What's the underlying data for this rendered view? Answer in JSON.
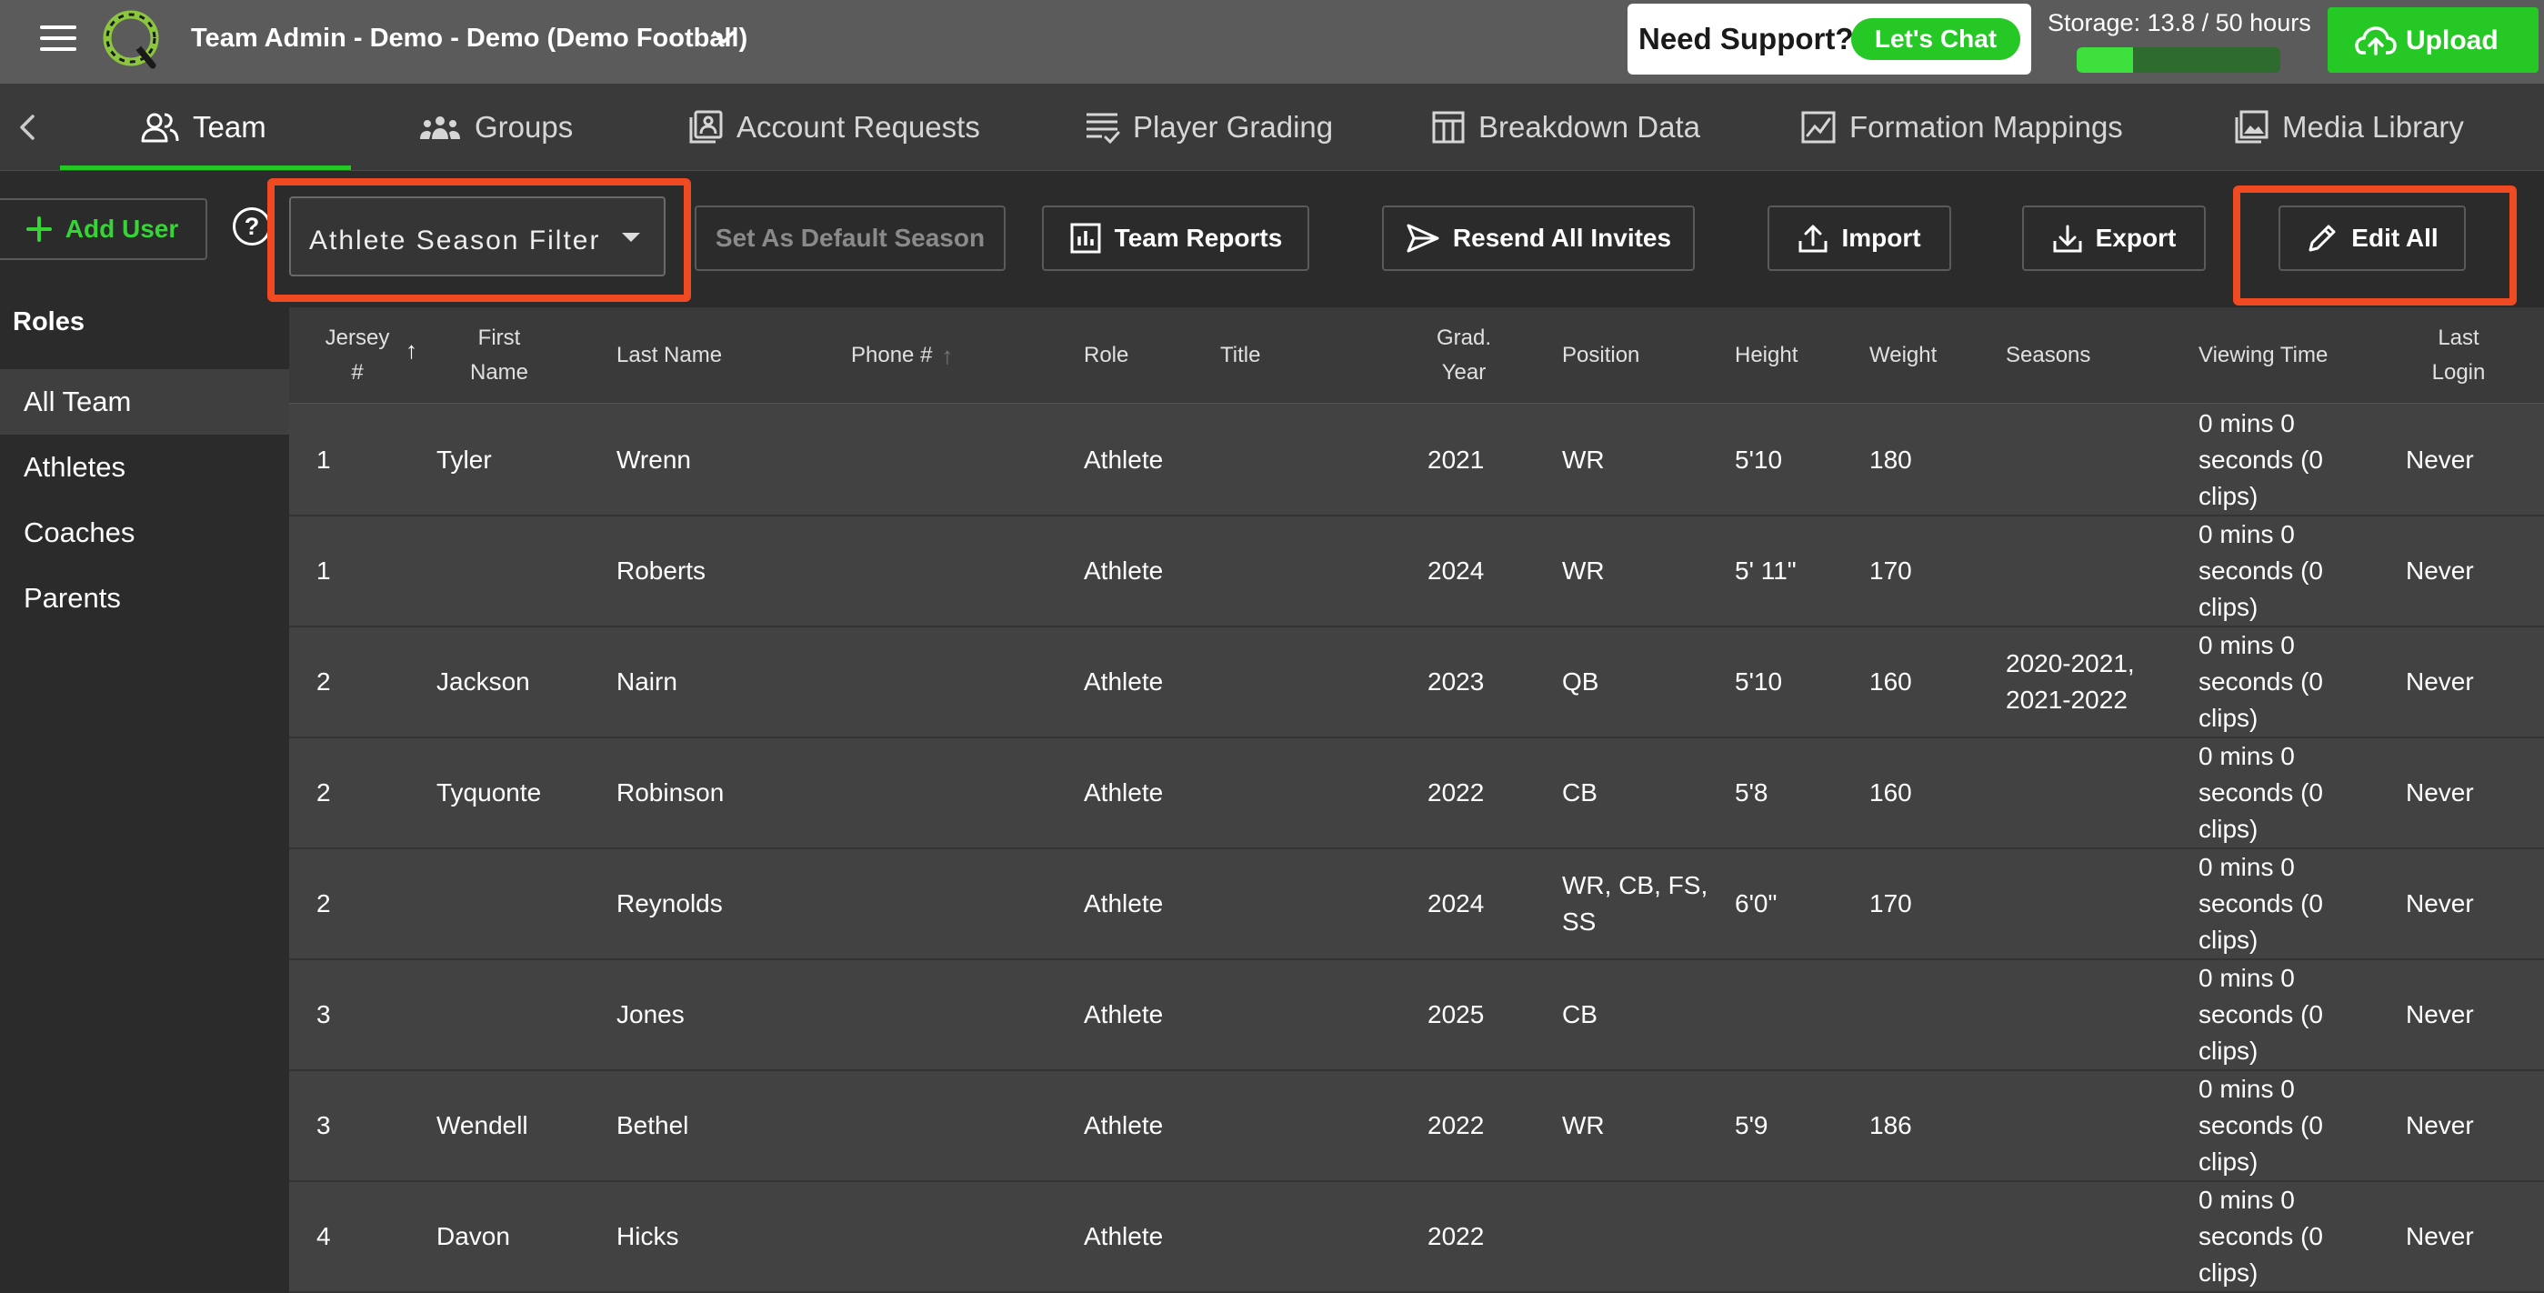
{
  "header": {
    "team_title": "Team Admin - Demo - Demo (Demo Football)",
    "support_text": "Need Support?",
    "chat_label": "Let's Chat",
    "storage_label": "Storage: 13.8 / 50 hours",
    "storage_fraction": 0.276,
    "upload_label": "Upload"
  },
  "tabs": [
    {
      "label": "Team",
      "icon": "team-icon",
      "active": true
    },
    {
      "label": "Groups",
      "icon": "groups-icon"
    },
    {
      "label": "Account Requests",
      "icon": "account-requests-icon"
    },
    {
      "label": "Player Grading",
      "icon": "grading-icon"
    },
    {
      "label": "Breakdown Data",
      "icon": "table-icon"
    },
    {
      "label": "Formation Mappings",
      "icon": "formation-icon"
    },
    {
      "label": "Media Library",
      "icon": "media-icon"
    }
  ],
  "toolbar": {
    "add_user": "Add User",
    "help": "?",
    "season_filter": "Athlete Season Filter",
    "set_default": "Set As Default Season",
    "team_reports": "Team Reports",
    "resend_invites": "Resend All Invites",
    "import": "Import",
    "export": "Export",
    "edit_all": "Edit All"
  },
  "sidebar": {
    "heading": "Roles",
    "items": [
      "All Team",
      "Athletes",
      "Coaches",
      "Parents"
    ]
  },
  "table": {
    "headers": {
      "jersey": "Jersey #",
      "first": "First Name",
      "last": "Last Name",
      "phone": "Phone #",
      "role": "Role",
      "title": "Title",
      "grad": "Grad. Year",
      "position": "Position",
      "height": "Height",
      "weight": "Weight",
      "seasons": "Seasons",
      "viewing": "Viewing Time",
      "login": "Last Login"
    },
    "rows": [
      {
        "jersey": "1",
        "first": "Tyler",
        "last": "Wrenn",
        "phone": "",
        "role": "Athlete",
        "title": "",
        "grad": "2021",
        "position": "WR",
        "height": "5'10",
        "weight": "180",
        "seasons": "",
        "viewing": "0 mins 0 seconds (0 clips)",
        "login": "Never"
      },
      {
        "jersey": "1",
        "first": "",
        "last": "Roberts",
        "phone": "",
        "role": "Athlete",
        "title": "",
        "grad": "2024",
        "position": "WR",
        "height": "5' 11\"",
        "weight": "170",
        "seasons": "",
        "viewing": "0 mins 0 seconds (0 clips)",
        "login": "Never"
      },
      {
        "jersey": "2",
        "first": "Jackson",
        "last": "Nairn",
        "phone": "",
        "role": "Athlete",
        "title": "",
        "grad": "2023",
        "position": "QB",
        "height": "5'10",
        "weight": "160",
        "seasons": "2020-2021, 2021-2022",
        "viewing": "0 mins 0 seconds (0 clips)",
        "login": "Never"
      },
      {
        "jersey": "2",
        "first": "Tyquonte",
        "last": "Robinson",
        "phone": "",
        "role": "Athlete",
        "title": "",
        "grad": "2022",
        "position": "CB",
        "height": "5'8",
        "weight": "160",
        "seasons": "",
        "viewing": "0 mins 0 seconds (0 clips)",
        "login": "Never"
      },
      {
        "jersey": "2",
        "first": "",
        "last": "Reynolds",
        "phone": "",
        "role": "Athlete",
        "title": "",
        "grad": "2024",
        "position": "WR, CB, FS, SS",
        "height": "6'0\"",
        "weight": "170",
        "seasons": "",
        "viewing": "0 mins 0 seconds (0 clips)",
        "login": "Never"
      },
      {
        "jersey": "3",
        "first": "",
        "last": "Jones",
        "phone": "",
        "role": "Athlete",
        "title": "",
        "grad": "2025",
        "position": "CB",
        "height": "",
        "weight": "",
        "seasons": "",
        "viewing": "0 mins 0 seconds (0 clips)",
        "login": "Never"
      },
      {
        "jersey": "3",
        "first": "Wendell",
        "last": "Bethel",
        "phone": "",
        "role": "Athlete",
        "title": "",
        "grad": "2022",
        "position": "WR",
        "height": "5'9",
        "weight": "186",
        "seasons": "",
        "viewing": "0 mins 0 seconds (0 clips)",
        "login": "Never"
      },
      {
        "jersey": "4",
        "first": "Davon",
        "last": "Hicks",
        "phone": "",
        "role": "Athlete",
        "title": "",
        "grad": "2022",
        "position": "",
        "height": "",
        "weight": "",
        "seasons": "",
        "viewing": "0 mins 0 seconds (0 clips)",
        "login": "Never"
      }
    ]
  },
  "colors": {
    "accent_green": "#26c826",
    "highlight_red": "#f04a22",
    "topbar": "#5b5b5b",
    "row_bg": "#424242"
  }
}
